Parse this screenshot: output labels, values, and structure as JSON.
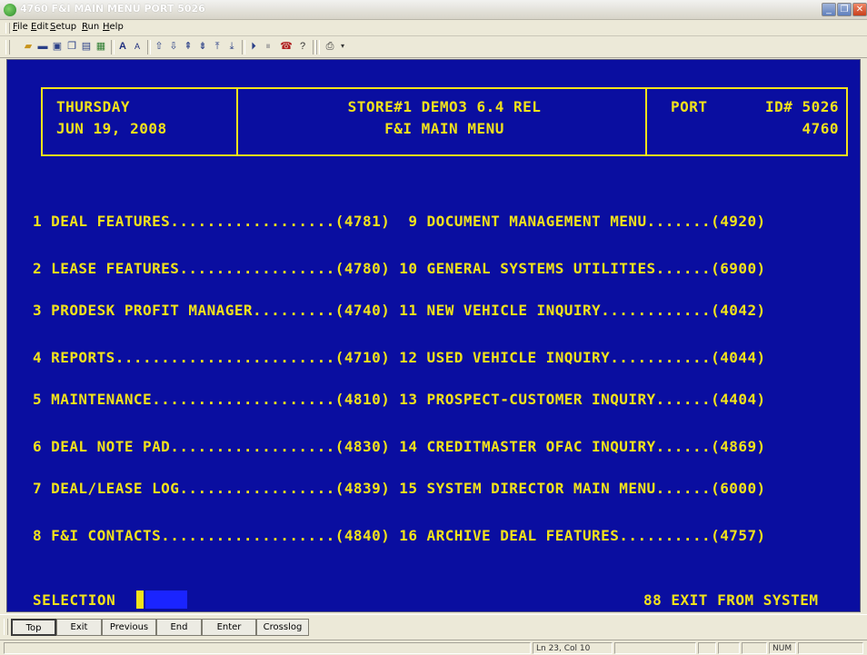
{
  "window": {
    "title": "4760 F&I MAIN MENU PORT 5026"
  },
  "menubar": {
    "items": [
      "File",
      "Edit",
      "Setup",
      "Run",
      "Help"
    ]
  },
  "toolbar": {
    "icons": [
      "open-icon",
      "screen-icon",
      "save-icon",
      "copy-icon",
      "paste-icon",
      "print-screen-icon",
      "font-increase-icon",
      "font-decrease-icon",
      "arrow-up-icon",
      "arrow-down-icon",
      "page-up-icon",
      "page-down-icon",
      "top-icon",
      "bottom-icon",
      "record-icon",
      "stop-icon",
      "phone-icon",
      "help-icon",
      "printer-icon"
    ]
  },
  "header": {
    "day": "THURSDAY",
    "date": "JUN 19, 2008",
    "store_line": "STORE#1 DEMO3 6.4 REL",
    "menu_title": "F&I MAIN MENU",
    "port_label": "PORT",
    "id_label": "ID# 5026",
    "menu_number": "4760"
  },
  "menu_lines": [
    "1 DEAL FEATURES..................(4781)  9 DOCUMENT MANAGEMENT MENU.......(4920)",
    "2 LEASE FEATURES.................(4780) 10 GENERAL SYSTEMS UTILITIES......(6900)",
    "3 PRODESK PROFIT MANAGER.........(4740) 11 NEW VEHICLE INQUIRY............(4042)",
    "4 REPORTS........................(4710) 12 USED VEHICLE INQUIRY...........(4044)",
    "5 MAINTENANCE....................(4810) 13 PROSPECT-CUSTOMER INQUIRY......(4404)",
    "6 DEAL NOTE PAD..................(4830) 14 CREDITMASTER OFAC INQUIRY......(4869)",
    "7 DEAL/LEASE LOG.................(4839) 15 SYSTEM DIRECTOR MAIN MENU......(6000)",
    "8 F&I CONTACTS...................(4840) 16 ARCHIVE DEAL FEATURES..........(4757)"
  ],
  "footer": {
    "selection_label": "SELECTION",
    "selection_value": "",
    "exit_text": "88 EXIT FROM SYSTEM"
  },
  "fkeys": [
    "Top",
    "Exit",
    "Previous",
    "End",
    "Enter",
    "Crosslog"
  ],
  "status": {
    "position": "Ln 23, Col 10",
    "num": "NUM"
  },
  "colors": {
    "terminal_bg": "#0a0ea0",
    "terminal_text": "#f2e21b",
    "selection_field": "#1a24ff"
  }
}
